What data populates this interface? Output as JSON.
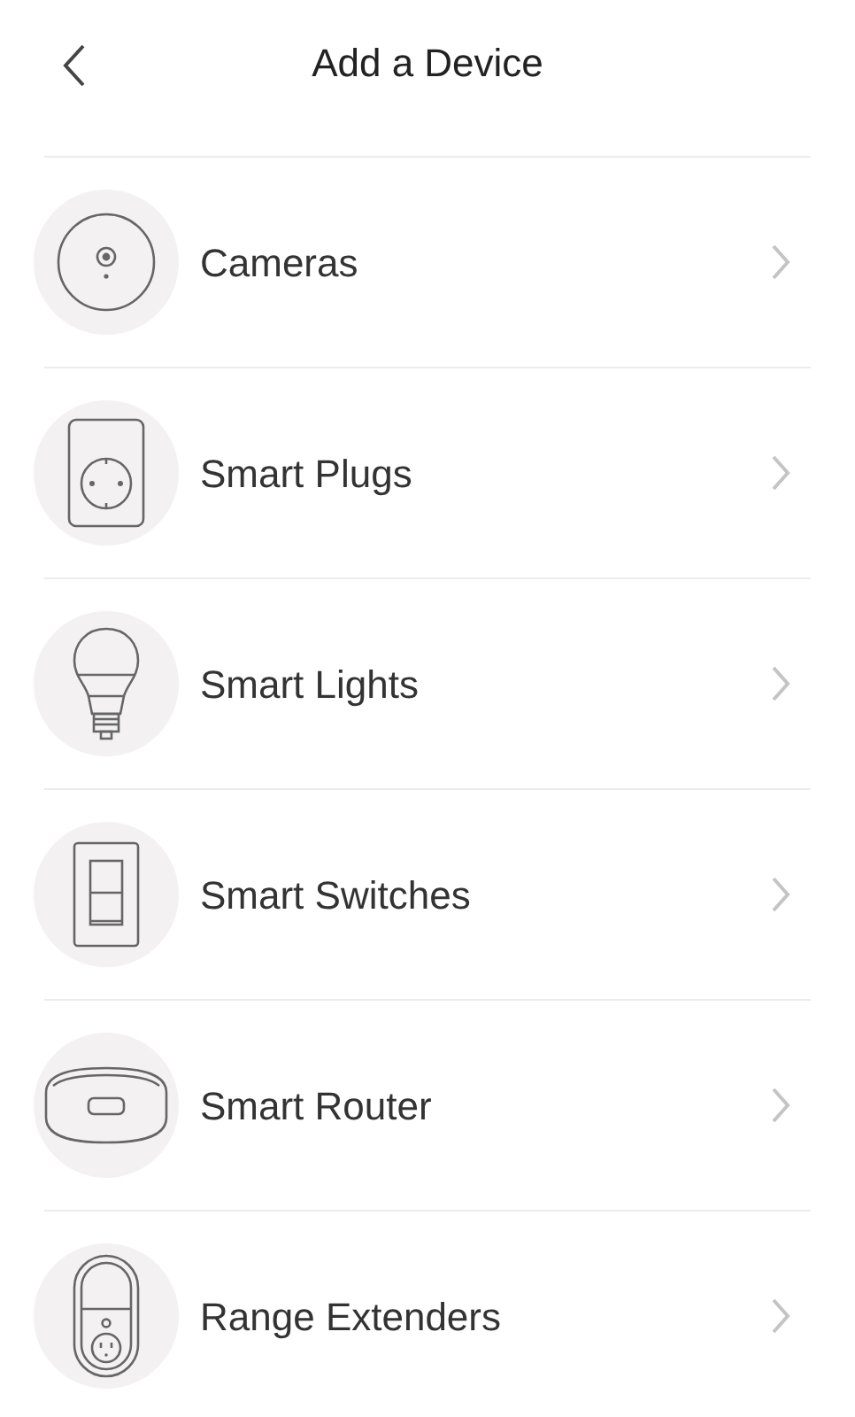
{
  "header": {
    "title": "Add a Device"
  },
  "devices": [
    {
      "kind": "camera",
      "label": "Cameras"
    },
    {
      "kind": "plug",
      "label": "Smart Plugs"
    },
    {
      "kind": "bulb",
      "label": "Smart Lights"
    },
    {
      "kind": "switch",
      "label": "Smart Switches"
    },
    {
      "kind": "router",
      "label": "Smart Router"
    },
    {
      "kind": "extender",
      "label": "Range Extenders"
    }
  ]
}
